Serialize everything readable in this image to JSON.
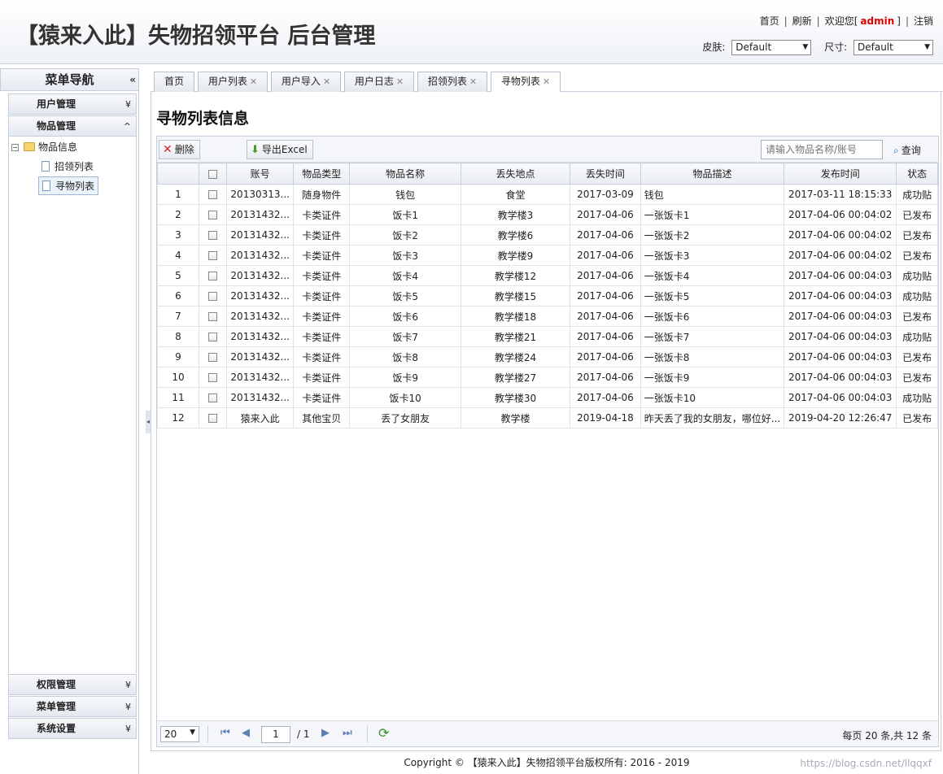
{
  "header": {
    "title": "【猿来入此】失物招领平台 后台管理",
    "links": {
      "home": "首页",
      "refresh": "刷新",
      "welcome_prefix": "欢迎您[",
      "user": "admin",
      "welcome_suffix": "]",
      "logout": "注销"
    },
    "skin_label": "皮肤:",
    "skin_value": "Default",
    "size_label": "尺寸:",
    "size_value": "Default"
  },
  "sidebar": {
    "title": "菜单导航",
    "collapse_icon": "«",
    "top_sections": [
      {
        "label": "用户管理",
        "chev": "¥"
      },
      {
        "label": "物品管理",
        "chev": "^"
      }
    ],
    "tree": {
      "root": "物品信息",
      "children": [
        "招领列表",
        "寻物列表"
      ]
    },
    "bottom_sections": [
      {
        "label": "权限管理"
      },
      {
        "label": "菜单管理"
      },
      {
        "label": "系统设置"
      }
    ]
  },
  "tabs": [
    {
      "label": "首页"
    },
    {
      "label": "用户列表"
    },
    {
      "label": "用户导入"
    },
    {
      "label": "用户日志"
    },
    {
      "label": "招领列表"
    },
    {
      "label": "寻物列表"
    }
  ],
  "page": {
    "title": "寻物列表信息",
    "delete_label": "删除",
    "export_label": "导出Excel",
    "search_placeholder": "请输入物品名称/账号",
    "search_label": "查询"
  },
  "table": {
    "headers": [
      "账号",
      "物品类型",
      "物品名称",
      "丢失地点",
      "丢失时间",
      "物品描述",
      "发布时间",
      "状态"
    ],
    "rows": [
      [
        "1",
        "20130313...",
        "随身物件",
        "钱包",
        "食堂",
        "2017-03-09",
        "钱包",
        "2017-03-11 18:15:33",
        "成功贴"
      ],
      [
        "2",
        "20131432...",
        "卡类证件",
        "饭卡1",
        "教学楼3",
        "2017-04-06",
        "一张饭卡1",
        "2017-04-06 00:04:02",
        "已发布"
      ],
      [
        "3",
        "20131432...",
        "卡类证件",
        "饭卡2",
        "教学楼6",
        "2017-04-06",
        "一张饭卡2",
        "2017-04-06 00:04:02",
        "已发布"
      ],
      [
        "4",
        "20131432...",
        "卡类证件",
        "饭卡3",
        "教学楼9",
        "2017-04-06",
        "一张饭卡3",
        "2017-04-06 00:04:02",
        "已发布"
      ],
      [
        "5",
        "20131432...",
        "卡类证件",
        "饭卡4",
        "教学楼12",
        "2017-04-06",
        "一张饭卡4",
        "2017-04-06 00:04:03",
        "成功贴"
      ],
      [
        "6",
        "20131432...",
        "卡类证件",
        "饭卡5",
        "教学楼15",
        "2017-04-06",
        "一张饭卡5",
        "2017-04-06 00:04:03",
        "成功贴"
      ],
      [
        "7",
        "20131432...",
        "卡类证件",
        "饭卡6",
        "教学楼18",
        "2017-04-06",
        "一张饭卡6",
        "2017-04-06 00:04:03",
        "已发布"
      ],
      [
        "8",
        "20131432...",
        "卡类证件",
        "饭卡7",
        "教学楼21",
        "2017-04-06",
        "一张饭卡7",
        "2017-04-06 00:04:03",
        "成功贴"
      ],
      [
        "9",
        "20131432...",
        "卡类证件",
        "饭卡8",
        "教学楼24",
        "2017-04-06",
        "一张饭卡8",
        "2017-04-06 00:04:03",
        "已发布"
      ],
      [
        "10",
        "20131432...",
        "卡类证件",
        "饭卡9",
        "教学楼27",
        "2017-04-06",
        "一张饭卡9",
        "2017-04-06 00:04:03",
        "已发布"
      ],
      [
        "11",
        "20131432...",
        "卡类证件",
        "饭卡10",
        "教学楼30",
        "2017-04-06",
        "一张饭卡10",
        "2017-04-06 00:04:03",
        "成功贴"
      ],
      [
        "12",
        "",
        "猿来入此",
        "其他宝贝",
        "丢了女朋友",
        "教学楼",
        "2019-04-18",
        "昨天丢了我的女朋友，哪位好...",
        "2019-04-20 12:26:47",
        "已发布"
      ]
    ]
  },
  "pager": {
    "page_size": "20",
    "current_page": "1",
    "total_pages": "/ 1",
    "info": "每页 20 条,共 12 条"
  },
  "footer": {
    "copyright": "Copyright © 【猿来入此】失物招领平台版权所有: 2016 - 2019",
    "watermark": "https://blog.csdn.net/llqqxf"
  }
}
